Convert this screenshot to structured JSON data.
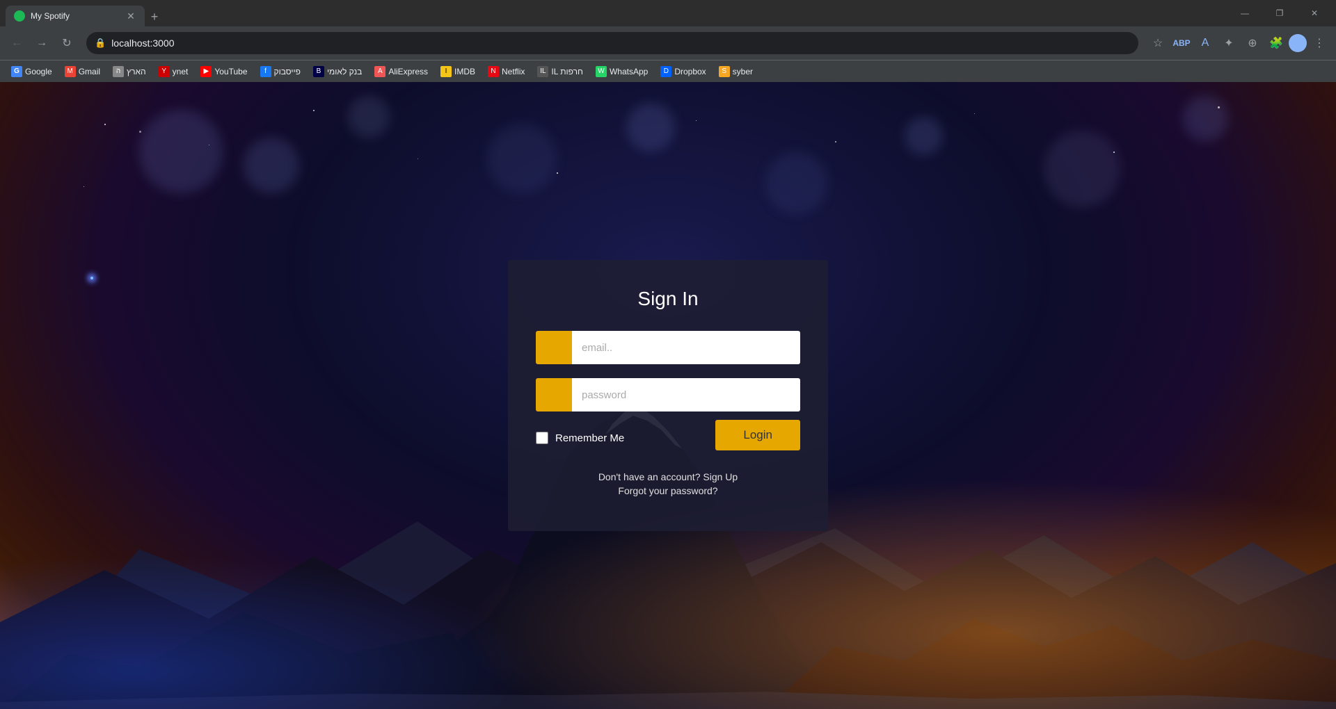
{
  "browser": {
    "tab": {
      "title": "My Spotify",
      "favicon_color": "#1db954"
    },
    "address": "localhost:3000",
    "window_controls": {
      "minimize": "—",
      "maximize": "❐",
      "close": "✕"
    }
  },
  "bookmarks": [
    {
      "label": "Google",
      "icon": "G",
      "class": "bm-google"
    },
    {
      "label": "Gmail",
      "icon": "M",
      "class": "bm-gmail"
    },
    {
      "label": "הארץ",
      "icon": "ה",
      "class": "bm-haaretz"
    },
    {
      "label": "ynet",
      "icon": "Y",
      "class": "bm-ynet"
    },
    {
      "label": "YouTube",
      "icon": "▶",
      "class": "bm-yt"
    },
    {
      "label": "פייסבוק",
      "icon": "f",
      "class": "bm-fb"
    },
    {
      "label": "בנק לאומי",
      "icon": "B",
      "class": "bm-bank"
    },
    {
      "label": "AliExpress",
      "icon": "A",
      "class": "bm-ali"
    },
    {
      "label": "IMDB",
      "icon": "I",
      "class": "bm-imdb"
    },
    {
      "label": "Netflix",
      "icon": "N",
      "class": "bm-netflix"
    },
    {
      "label": "IL חרפות",
      "icon": "IL",
      "class": "bm-il"
    },
    {
      "label": "WhatsApp",
      "icon": "W",
      "class": "bm-whatsapp"
    },
    {
      "label": "Dropbox",
      "icon": "D",
      "class": "bm-dropbox"
    },
    {
      "label": "syber",
      "icon": "S",
      "class": "bm-syber"
    }
  ],
  "login": {
    "title": "Sign In",
    "email_placeholder": "email..",
    "password_placeholder": "password",
    "remember_label": "Remember Me",
    "login_label": "Login",
    "signup_text": "Don't have an account? Sign Up",
    "forgot_text": "Forgot your password?"
  }
}
